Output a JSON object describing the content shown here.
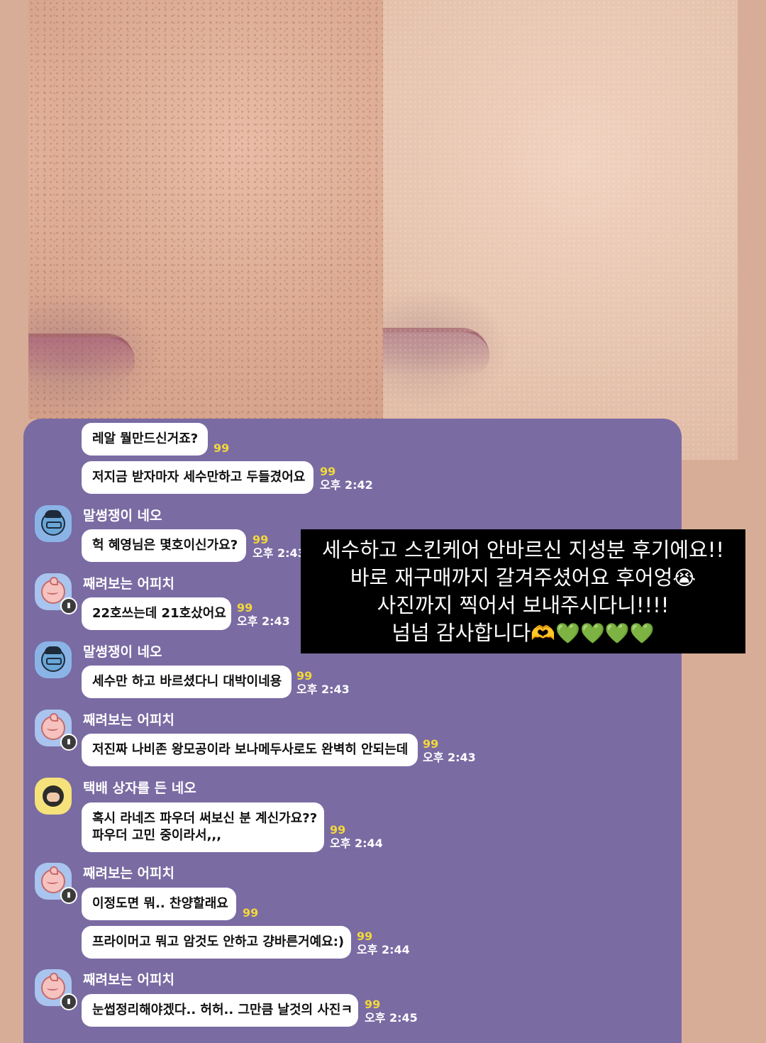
{
  "caption": {
    "line1": "세수하고 스킨케어 안바르신 지성분 후기에요!!",
    "line2_text": "바로 재구매까지 갈겨주셨어요 후어엉",
    "line2_emoji": "😭",
    "line3": "사진까지 찍어서 보내주시다니!!!!",
    "line4_text": "넘넘 감사합니다",
    "line4_emoji": "🫶💚💚💚💚"
  },
  "messages": [
    {
      "text": "레알 뭘만드신거죠?",
      "count": "99",
      "time": ""
    },
    {
      "text": "저지금 받자마자 세수만하고 두들겼어요",
      "count": "99",
      "time": "오후 2:42"
    },
    {
      "sender": "말썽쟁이 네오",
      "text": "헉 혜영님은 몇호이신가요?",
      "count": "99",
      "time": "오후 2:43"
    },
    {
      "sender": "째려보는 어피치",
      "text": "22호쓰는데 21호샀어요",
      "count": "99",
      "time": "오후 2:43"
    },
    {
      "sender": "말썽쟁이 네오",
      "text": "세수만 하고 바르셨다니 대박이네용",
      "count": "99",
      "time": "오후 2:43"
    },
    {
      "sender": "째려보는 어피치",
      "text": "저진짜 나비존 왕모공이라 보나메두사로도 완벽히 안되는데",
      "count": "99",
      "time": "오후 2:43"
    },
    {
      "sender": "택배 상자를 든 네오",
      "text_line1": "혹시 라네즈 파우더 써보신 분 계신가요??",
      "text_line2": "파우더 고민 중이라서,,,",
      "count": "99",
      "time": "오후 2:44"
    },
    {
      "sender": "째려보는 어피치",
      "text": "이정도면 뭐.. 찬양할래요",
      "count": "99",
      "time": ""
    },
    {
      "text": "프라이머고 뭐고 암것도 안하고 걍바른거예요:)",
      "count": "99",
      "time": "오후 2:44"
    },
    {
      "sender": "째려보는 어피치",
      "text": "눈썹정리해야겠다.. 허허.. 그만큼 날것의 사진ㅋ",
      "count": "99",
      "time": "오후 2:45"
    }
  ],
  "avatars": {
    "neo": "neo-avatar-icon",
    "apeach": "apeach-avatar-icon",
    "box_neo": "box-neo-avatar-icon"
  },
  "colors": {
    "chat_background": "#7a6ba3",
    "bubble": "#ffffff",
    "unread_count": "#f2d83b",
    "caption_background": "#000000"
  }
}
